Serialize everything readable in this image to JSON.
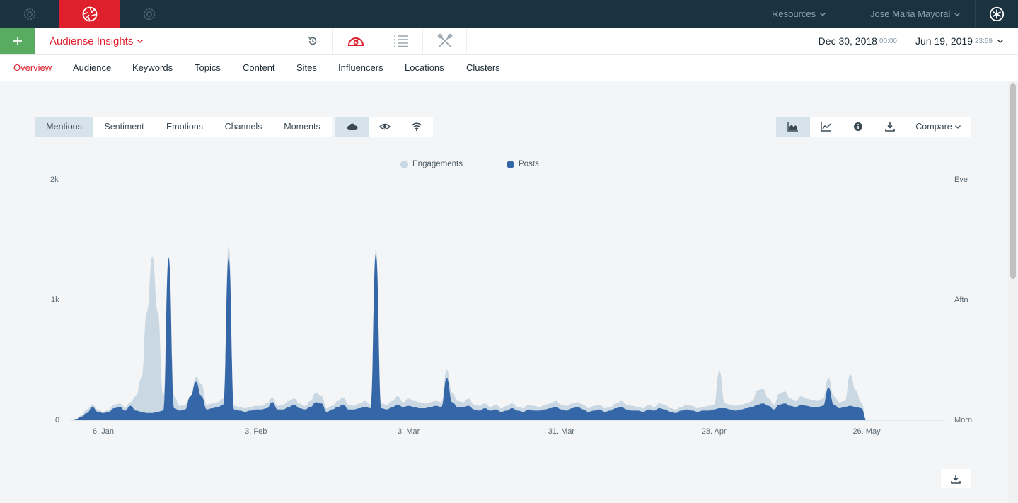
{
  "topbar": {
    "resources_label": "Resources",
    "user_name": "Jose Maria Mayoral"
  },
  "header": {
    "app_title": "Audiense Insights",
    "date_from": "Dec 30, 2018",
    "time_from": "00:00",
    "date_sep": "—",
    "date_to": "Jun 19, 2019",
    "time_to": "23:59"
  },
  "nav": {
    "tabs": [
      "Overview",
      "Audience",
      "Keywords",
      "Topics",
      "Content",
      "Sites",
      "Influencers",
      "Locations",
      "Clusters"
    ],
    "active": "Overview"
  },
  "chart_toolbar": {
    "modes": [
      "Mentions",
      "Sentiment",
      "Emotions",
      "Channels",
      "Moments"
    ],
    "active_mode": "Mentions",
    "compare_label": "Compare"
  },
  "colors": {
    "accent": "#e01f2d",
    "topbar": "#1b3241",
    "engagements": "#c9d8e3",
    "posts": "#3466a8"
  },
  "chart_data": {
    "type": "area",
    "series": [
      {
        "name": "Engagements",
        "color": "#c9d8e3"
      },
      {
        "name": "Posts",
        "color": "#3466a8"
      }
    ],
    "x_ticks": [
      "6. Jan",
      "3. Feb",
      "3. Mar",
      "31. Mar",
      "28. Apr",
      "26. May"
    ],
    "y_ticks_left": [
      "0",
      "1k",
      "2k"
    ],
    "y_ticks_right": [
      "Morn",
      "Aftn",
      "Eve"
    ],
    "ylim": [
      0,
      2000
    ],
    "x_domain": [
      "2018-12-30",
      "2019-06-19"
    ],
    "grid": false,
    "legend_position": "top-center",
    "engagements_points": [
      [
        "2018-12-31",
        0
      ],
      [
        "2019-01-01",
        10
      ],
      [
        "2019-01-02",
        40
      ],
      [
        "2019-01-03",
        90
      ],
      [
        "2019-01-04",
        130
      ],
      [
        "2019-01-05",
        90
      ],
      [
        "2019-01-06",
        70
      ],
      [
        "2019-01-07",
        90
      ],
      [
        "2019-01-08",
        130
      ],
      [
        "2019-01-09",
        140
      ],
      [
        "2019-01-10",
        110
      ],
      [
        "2019-01-11",
        150
      ],
      [
        "2019-01-12",
        200
      ],
      [
        "2019-01-13",
        350
      ],
      [
        "2019-01-14",
        900
      ],
      [
        "2019-01-15",
        1360
      ],
      [
        "2019-01-16",
        900
      ],
      [
        "2019-01-17",
        200
      ],
      [
        "2019-01-18",
        1350
      ],
      [
        "2019-01-19",
        200
      ],
      [
        "2019-01-20",
        120
      ],
      [
        "2019-01-21",
        130
      ],
      [
        "2019-01-22",
        200
      ],
      [
        "2019-01-23",
        360
      ],
      [
        "2019-01-24",
        300
      ],
      [
        "2019-01-25",
        130
      ],
      [
        "2019-01-26",
        140
      ],
      [
        "2019-01-27",
        150
      ],
      [
        "2019-01-28",
        180
      ],
      [
        "2019-01-29",
        1450
      ],
      [
        "2019-01-30",
        120
      ],
      [
        "2019-01-31",
        110
      ],
      [
        "2019-02-01",
        100
      ],
      [
        "2019-02-02",
        110
      ],
      [
        "2019-02-03",
        120
      ],
      [
        "2019-02-04",
        120
      ],
      [
        "2019-02-05",
        140
      ],
      [
        "2019-02-06",
        190
      ],
      [
        "2019-02-07",
        120
      ],
      [
        "2019-02-08",
        130
      ],
      [
        "2019-02-09",
        160
      ],
      [
        "2019-02-10",
        180
      ],
      [
        "2019-02-11",
        140
      ],
      [
        "2019-02-12",
        120
      ],
      [
        "2019-02-13",
        160
      ],
      [
        "2019-02-14",
        230
      ],
      [
        "2019-02-15",
        200
      ],
      [
        "2019-02-16",
        100
      ],
      [
        "2019-02-17",
        120
      ],
      [
        "2019-02-18",
        160
      ],
      [
        "2019-02-19",
        190
      ],
      [
        "2019-02-20",
        130
      ],
      [
        "2019-02-21",
        120
      ],
      [
        "2019-02-22",
        140
      ],
      [
        "2019-02-23",
        160
      ],
      [
        "2019-02-24",
        130
      ],
      [
        "2019-02-25",
        1420
      ],
      [
        "2019-02-26",
        140
      ],
      [
        "2019-02-27",
        130
      ],
      [
        "2019-02-28",
        160
      ],
      [
        "2019-03-01",
        200
      ],
      [
        "2019-03-02",
        150
      ],
      [
        "2019-03-03",
        180
      ],
      [
        "2019-03-04",
        160
      ],
      [
        "2019-03-05",
        150
      ],
      [
        "2019-03-06",
        140
      ],
      [
        "2019-03-07",
        150
      ],
      [
        "2019-03-08",
        160
      ],
      [
        "2019-03-09",
        150
      ],
      [
        "2019-03-10",
        420
      ],
      [
        "2019-03-11",
        230
      ],
      [
        "2019-03-12",
        160
      ],
      [
        "2019-03-13",
        150
      ],
      [
        "2019-03-14",
        180
      ],
      [
        "2019-03-15",
        130
      ],
      [
        "2019-03-16",
        120
      ],
      [
        "2019-03-17",
        140
      ],
      [
        "2019-03-18",
        110
      ],
      [
        "2019-03-19",
        130
      ],
      [
        "2019-03-20",
        100
      ],
      [
        "2019-03-21",
        120
      ],
      [
        "2019-03-22",
        140
      ],
      [
        "2019-03-23",
        110
      ],
      [
        "2019-03-24",
        100
      ],
      [
        "2019-03-25",
        130
      ],
      [
        "2019-03-26",
        120
      ],
      [
        "2019-03-27",
        110
      ],
      [
        "2019-03-28",
        130
      ],
      [
        "2019-03-29",
        140
      ],
      [
        "2019-03-30",
        160
      ],
      [
        "2019-03-31",
        130
      ],
      [
        "2019-04-01",
        120
      ],
      [
        "2019-04-02",
        140
      ],
      [
        "2019-04-03",
        150
      ],
      [
        "2019-04-04",
        130
      ],
      [
        "2019-04-05",
        100
      ],
      [
        "2019-04-06",
        120
      ],
      [
        "2019-04-07",
        130
      ],
      [
        "2019-04-08",
        100
      ],
      [
        "2019-04-09",
        110
      ],
      [
        "2019-04-10",
        140
      ],
      [
        "2019-04-11",
        160
      ],
      [
        "2019-04-12",
        130
      ],
      [
        "2019-04-13",
        120
      ],
      [
        "2019-04-14",
        110
      ],
      [
        "2019-04-15",
        100
      ],
      [
        "2019-04-16",
        130
      ],
      [
        "2019-04-17",
        110
      ],
      [
        "2019-04-18",
        140
      ],
      [
        "2019-04-19",
        130
      ],
      [
        "2019-04-20",
        100
      ],
      [
        "2019-04-21",
        90
      ],
      [
        "2019-04-22",
        110
      ],
      [
        "2019-04-23",
        130
      ],
      [
        "2019-04-24",
        120
      ],
      [
        "2019-04-25",
        100
      ],
      [
        "2019-04-26",
        110
      ],
      [
        "2019-04-27",
        120
      ],
      [
        "2019-04-28",
        130
      ],
      [
        "2019-04-29",
        410
      ],
      [
        "2019-04-30",
        140
      ],
      [
        "2019-05-01",
        130
      ],
      [
        "2019-05-02",
        120
      ],
      [
        "2019-05-03",
        130
      ],
      [
        "2019-05-04",
        140
      ],
      [
        "2019-05-05",
        160
      ],
      [
        "2019-05-06",
        250
      ],
      [
        "2019-05-07",
        260
      ],
      [
        "2019-05-08",
        180
      ],
      [
        "2019-05-09",
        130
      ],
      [
        "2019-05-10",
        220
      ],
      [
        "2019-05-11",
        240
      ],
      [
        "2019-05-12",
        180
      ],
      [
        "2019-05-13",
        160
      ],
      [
        "2019-05-14",
        200
      ],
      [
        "2019-05-15",
        180
      ],
      [
        "2019-05-16",
        170
      ],
      [
        "2019-05-17",
        160
      ],
      [
        "2019-05-18",
        180
      ],
      [
        "2019-05-19",
        350
      ],
      [
        "2019-05-20",
        200
      ],
      [
        "2019-05-21",
        150
      ],
      [
        "2019-05-22",
        160
      ],
      [
        "2019-05-23",
        380
      ],
      [
        "2019-05-24",
        250
      ],
      [
        "2019-05-25",
        150
      ],
      [
        "2019-05-26",
        0
      ]
    ],
    "posts_points": [
      [
        "2018-12-31",
        0
      ],
      [
        "2019-01-01",
        10
      ],
      [
        "2019-01-02",
        30
      ],
      [
        "2019-01-03",
        60
      ],
      [
        "2019-01-04",
        110
      ],
      [
        "2019-01-05",
        70
      ],
      [
        "2019-01-06",
        60
      ],
      [
        "2019-01-07",
        70
      ],
      [
        "2019-01-08",
        100
      ],
      [
        "2019-01-09",
        110
      ],
      [
        "2019-01-10",
        80
      ],
      [
        "2019-01-11",
        120
      ],
      [
        "2019-01-12",
        80
      ],
      [
        "2019-01-13",
        70
      ],
      [
        "2019-01-14",
        60
      ],
      [
        "2019-01-15",
        60
      ],
      [
        "2019-01-16",
        70
      ],
      [
        "2019-01-17",
        80
      ],
      [
        "2019-01-18",
        1350
      ],
      [
        "2019-01-19",
        100
      ],
      [
        "2019-01-20",
        80
      ],
      [
        "2019-01-21",
        90
      ],
      [
        "2019-01-22",
        200
      ],
      [
        "2019-01-23",
        320
      ],
      [
        "2019-01-24",
        200
      ],
      [
        "2019-01-25",
        90
      ],
      [
        "2019-01-26",
        100
      ],
      [
        "2019-01-27",
        110
      ],
      [
        "2019-01-28",
        130
      ],
      [
        "2019-01-29",
        1350
      ],
      [
        "2019-01-30",
        90
      ],
      [
        "2019-01-31",
        80
      ],
      [
        "2019-02-01",
        70
      ],
      [
        "2019-02-02",
        80
      ],
      [
        "2019-02-03",
        90
      ],
      [
        "2019-02-04",
        90
      ],
      [
        "2019-02-05",
        100
      ],
      [
        "2019-02-06",
        150
      ],
      [
        "2019-02-07",
        90
      ],
      [
        "2019-02-08",
        90
      ],
      [
        "2019-02-09",
        110
      ],
      [
        "2019-02-10",
        130
      ],
      [
        "2019-02-11",
        100
      ],
      [
        "2019-02-12",
        90
      ],
      [
        "2019-02-13",
        110
      ],
      [
        "2019-02-14",
        150
      ],
      [
        "2019-02-15",
        140
      ],
      [
        "2019-02-16",
        70
      ],
      [
        "2019-02-17",
        90
      ],
      [
        "2019-02-18",
        110
      ],
      [
        "2019-02-19",
        130
      ],
      [
        "2019-02-20",
        90
      ],
      [
        "2019-02-21",
        90
      ],
      [
        "2019-02-22",
        100
      ],
      [
        "2019-02-23",
        110
      ],
      [
        "2019-02-24",
        100
      ],
      [
        "2019-02-25",
        1380
      ],
      [
        "2019-02-26",
        100
      ],
      [
        "2019-02-27",
        90
      ],
      [
        "2019-02-28",
        110
      ],
      [
        "2019-03-01",
        130
      ],
      [
        "2019-03-02",
        110
      ],
      [
        "2019-03-03",
        120
      ],
      [
        "2019-03-04",
        110
      ],
      [
        "2019-03-05",
        100
      ],
      [
        "2019-03-06",
        100
      ],
      [
        "2019-03-07",
        110
      ],
      [
        "2019-03-08",
        120
      ],
      [
        "2019-03-09",
        110
      ],
      [
        "2019-03-10",
        350
      ],
      [
        "2019-03-11",
        150
      ],
      [
        "2019-03-12",
        110
      ],
      [
        "2019-03-13",
        110
      ],
      [
        "2019-03-14",
        120
      ],
      [
        "2019-03-15",
        90
      ],
      [
        "2019-03-16",
        80
      ],
      [
        "2019-03-17",
        100
      ],
      [
        "2019-03-18",
        80
      ],
      [
        "2019-03-19",
        90
      ],
      [
        "2019-03-20",
        70
      ],
      [
        "2019-03-21",
        80
      ],
      [
        "2019-03-22",
        100
      ],
      [
        "2019-03-23",
        80
      ],
      [
        "2019-03-24",
        70
      ],
      [
        "2019-03-25",
        90
      ],
      [
        "2019-03-26",
        80
      ],
      [
        "2019-03-27",
        80
      ],
      [
        "2019-03-28",
        90
      ],
      [
        "2019-03-29",
        100
      ],
      [
        "2019-03-30",
        110
      ],
      [
        "2019-03-31",
        90
      ],
      [
        "2019-04-01",
        80
      ],
      [
        "2019-04-02",
        100
      ],
      [
        "2019-04-03",
        110
      ],
      [
        "2019-04-04",
        90
      ],
      [
        "2019-04-05",
        70
      ],
      [
        "2019-04-06",
        80
      ],
      [
        "2019-04-07",
        90
      ],
      [
        "2019-04-08",
        70
      ],
      [
        "2019-04-09",
        80
      ],
      [
        "2019-04-10",
        100
      ],
      [
        "2019-04-11",
        110
      ],
      [
        "2019-04-12",
        90
      ],
      [
        "2019-04-13",
        80
      ],
      [
        "2019-04-14",
        80
      ],
      [
        "2019-04-15",
        70
      ],
      [
        "2019-04-16",
        90
      ],
      [
        "2019-04-17",
        80
      ],
      [
        "2019-04-18",
        100
      ],
      [
        "2019-04-19",
        90
      ],
      [
        "2019-04-20",
        70
      ],
      [
        "2019-04-21",
        60
      ],
      [
        "2019-04-22",
        80
      ],
      [
        "2019-04-23",
        90
      ],
      [
        "2019-04-24",
        80
      ],
      [
        "2019-04-25",
        70
      ],
      [
        "2019-04-26",
        80
      ],
      [
        "2019-04-27",
        80
      ],
      [
        "2019-04-28",
        90
      ],
      [
        "2019-04-29",
        100
      ],
      [
        "2019-04-30",
        100
      ],
      [
        "2019-05-01",
        90
      ],
      [
        "2019-05-02",
        80
      ],
      [
        "2019-05-03",
        90
      ],
      [
        "2019-05-04",
        100
      ],
      [
        "2019-05-05",
        110
      ],
      [
        "2019-05-06",
        130
      ],
      [
        "2019-05-07",
        140
      ],
      [
        "2019-05-08",
        120
      ],
      [
        "2019-05-09",
        90
      ],
      [
        "2019-05-10",
        130
      ],
      [
        "2019-05-11",
        140
      ],
      [
        "2019-05-12",
        120
      ],
      [
        "2019-05-13",
        110
      ],
      [
        "2019-05-14",
        130
      ],
      [
        "2019-05-15",
        120
      ],
      [
        "2019-05-16",
        110
      ],
      [
        "2019-05-17",
        110
      ],
      [
        "2019-05-18",
        120
      ],
      [
        "2019-05-19",
        270
      ],
      [
        "2019-05-20",
        130
      ],
      [
        "2019-05-21",
        100
      ],
      [
        "2019-05-22",
        110
      ],
      [
        "2019-05-23",
        120
      ],
      [
        "2019-05-24",
        110
      ],
      [
        "2019-05-25",
        100
      ],
      [
        "2019-05-26",
        0
      ]
    ]
  }
}
